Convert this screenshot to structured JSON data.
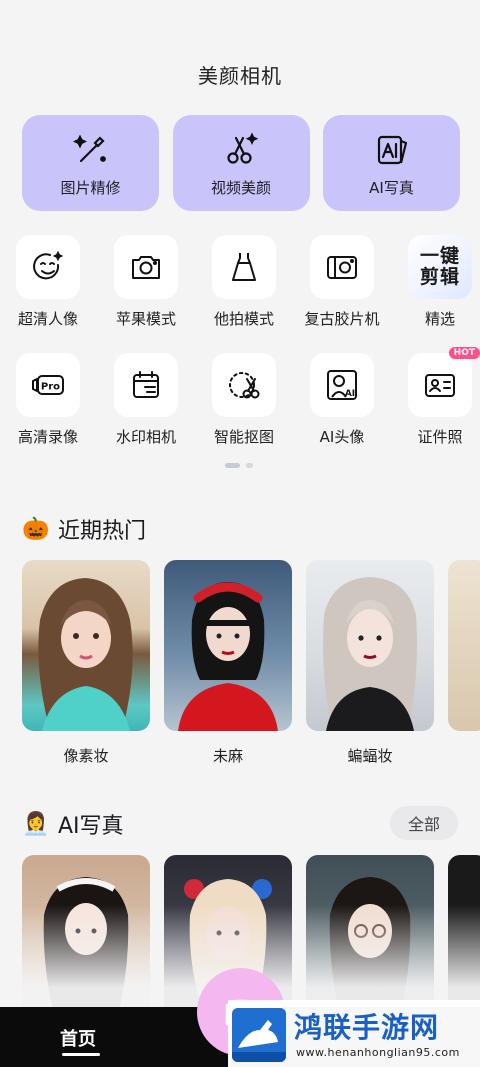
{
  "header": {
    "title": "美颜相机"
  },
  "top_cards": [
    {
      "label": "图片精修",
      "icon": "magic-wand-icon"
    },
    {
      "label": "视频美颜",
      "icon": "scissors-sparkle-icon"
    },
    {
      "label": "AI写真",
      "icon": "ai-photo-icon"
    }
  ],
  "tools_row1": [
    {
      "label": "超清人像",
      "icon": "smiley-face-icon"
    },
    {
      "label": "苹果模式",
      "icon": "camera-icon"
    },
    {
      "label": "他拍模式",
      "icon": "dress-icon"
    },
    {
      "label": "复古胶片机",
      "icon": "film-camera-icon"
    },
    {
      "label": "精选",
      "icon": "one-click-edit-icon",
      "badge_text": "一键剪辑"
    }
  ],
  "tools_row2": [
    {
      "label": "高清录像",
      "icon": "pro-video-icon"
    },
    {
      "label": "水印相机",
      "icon": "calendar-icon"
    },
    {
      "label": "智能抠图",
      "icon": "cutout-icon"
    },
    {
      "label": "AI头像",
      "icon": "ai-avatar-icon"
    },
    {
      "label": "证件照",
      "icon": "id-card-icon",
      "badge": "HOT"
    }
  ],
  "pager": {
    "pages": 2,
    "current": 1
  },
  "section_recent": {
    "emoji": "🎃",
    "title": "近期热门",
    "items": [
      {
        "caption": "像素妆"
      },
      {
        "caption": "未麻"
      },
      {
        "caption": "蝙蝠妆"
      }
    ]
  },
  "section_ai": {
    "emoji": "👩‍💼",
    "title": "AI写真",
    "all_label": "全部"
  },
  "bottom_nav": {
    "home_label": "首页"
  },
  "watermark": {
    "title": "鸿联手游网",
    "url": "www.henanhonglian95.com"
  },
  "colors": {
    "card_purple": "#c9c5fb",
    "fab_pink": "#f5b7ef",
    "hot_badge": "#ff4f8a"
  }
}
